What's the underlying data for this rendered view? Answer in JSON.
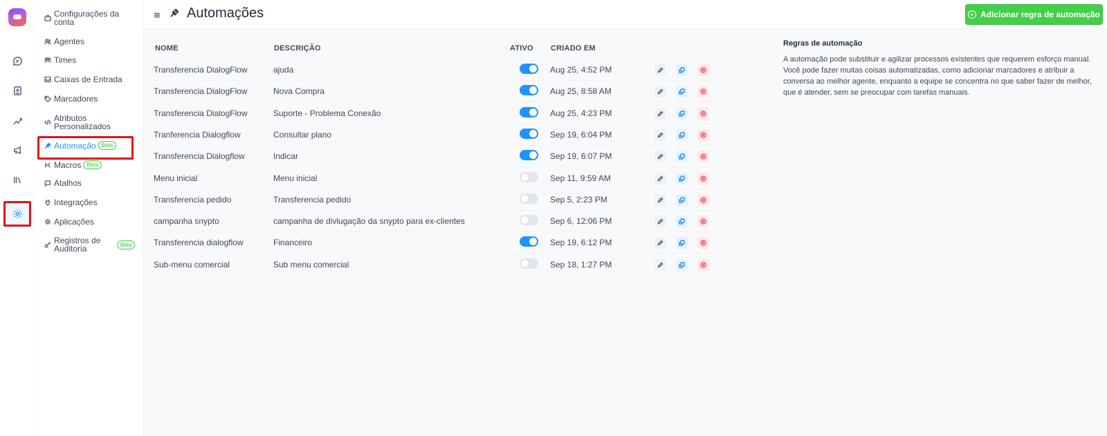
{
  "header": {
    "title": "Automações",
    "add_button_label": "Adicionar regra de automação"
  },
  "sidebar": {
    "items": [
      {
        "label": "Configurações da conta",
        "icon": "briefcase-icon"
      },
      {
        "label": "Agentes",
        "icon": "people-icon"
      },
      {
        "label": "Times",
        "icon": "team-icon"
      },
      {
        "label": "Caixas de Entrada",
        "icon": "inbox-icon"
      },
      {
        "label": "Marcadores",
        "icon": "tag-icon"
      },
      {
        "label": "Atributos Personalizados",
        "icon": "code-icon"
      },
      {
        "label": "Automação",
        "icon": "automation-icon",
        "badge": "Beta",
        "active": true
      },
      {
        "label": "Macros",
        "icon": "macro-icon",
        "badge": "Beta"
      },
      {
        "label": "Atalhos",
        "icon": "chat-shortcut-icon"
      },
      {
        "label": "Integrações",
        "icon": "plug-icon"
      },
      {
        "label": "Aplicações",
        "icon": "apps-icon"
      },
      {
        "label": "Registros de Auditoria",
        "icon": "key-icon",
        "badge": "Beta"
      }
    ]
  },
  "rail": {
    "icons": [
      "conversations-icon",
      "contacts-icon",
      "reports-icon",
      "campaigns-icon",
      "library-icon",
      "settings-icon"
    ]
  },
  "table": {
    "headers": {
      "name": "NOME",
      "description": "DESCRIÇÃO",
      "active": "ATIVO",
      "created": "CRIADO EM"
    },
    "rows": [
      {
        "name": "Transferencia DialogFlow",
        "description": "ajuda",
        "active": true,
        "created": "Aug 25, 4:52 PM"
      },
      {
        "name": "Transferencia DialogFlow",
        "description": "Nova Compra",
        "active": true,
        "created": "Aug 25, 8:58 AM"
      },
      {
        "name": "Transferencia DialogFlow",
        "description": "Suporte - Problema Conexão",
        "active": true,
        "created": "Aug 25, 4:23 PM"
      },
      {
        "name": "Tranferencia Dialogflow",
        "description": "Consultar plano",
        "active": true,
        "created": "Sep 19, 6:04 PM"
      },
      {
        "name": "Transferencia Dialogflow",
        "description": "Indicar",
        "active": true,
        "created": "Sep 19, 6:07 PM"
      },
      {
        "name": "Menu inicial",
        "description": "Menu inicial",
        "active": false,
        "created": "Sep 11, 9:59 AM"
      },
      {
        "name": "Transferencia pedido",
        "description": "Transferencia pedido",
        "active": false,
        "created": "Sep 5, 2:23 PM"
      },
      {
        "name": "campanha snypto",
        "description": "campanha de divlugação da snypto para ex-clientes",
        "active": false,
        "created": "Sep 6, 12:06 PM"
      },
      {
        "name": "Transferencia dialogflow",
        "description": "Financeiro",
        "active": true,
        "created": "Sep 19, 6:12 PM"
      },
      {
        "name": "Sub-menu comercial",
        "description": "Sub menu comercial",
        "active": false,
        "created": "Sep 18, 1:27 PM"
      }
    ]
  },
  "info": {
    "title": "Regras de automação",
    "text": "A automação pode substituir e agilizar processos existentes que requerem esforço manual. Você pode fazer muitas coisas automatizadas, como adicionar marcadores e atribuir a conversa ao melhor agente, enquanto a equipe se concentra no que saber fazer de melhor, que é atender, sem se preocupar com tarefas manuais."
  },
  "colors": {
    "accent": "#1f93ff",
    "success": "#44ce4b",
    "danger": "#ff4f5f",
    "highlight_box": "#e3101a"
  }
}
